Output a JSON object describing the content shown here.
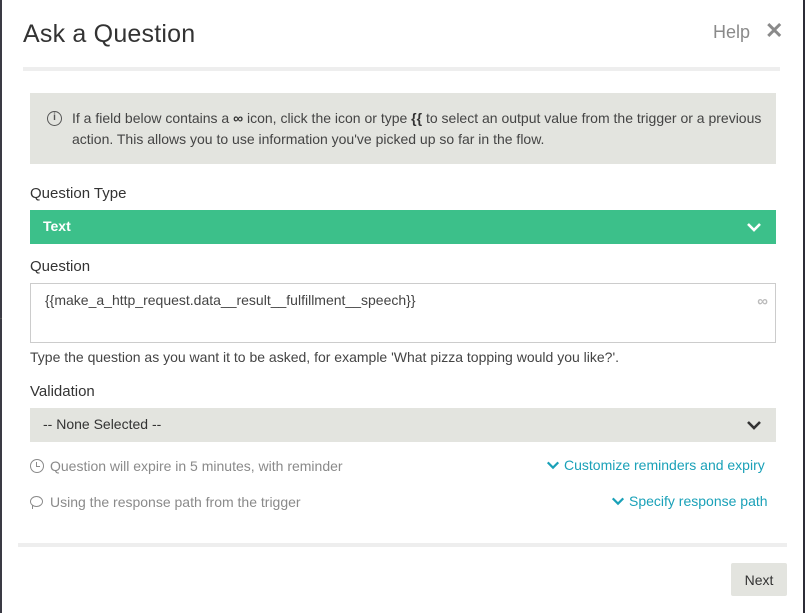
{
  "dialog": {
    "title": "Ask a Question",
    "help_label": "Help",
    "close_glyph": "✕"
  },
  "info": {
    "text_before": "If a field below contains a ",
    "icon_glyph": "∞",
    "text_middle": " icon, click the icon or type ",
    "braces": "{{",
    "text_after": " to select an output value from the trigger or a previous action. This allows you to use information you've picked up so far in the flow."
  },
  "question_type": {
    "label": "Question Type",
    "selected": "Text"
  },
  "question": {
    "label": "Question",
    "value": "{{make_a_http_request.data__result__fulfillment__speech}}",
    "insert_glyph": "∞",
    "hint": "Type the question as you want it to be asked, for example 'What pizza topping would you like?'."
  },
  "validation": {
    "label": "Validation",
    "selected": "-- None Selected --"
  },
  "expiry": {
    "status": "Question will expire in 5 minutes, with reminder",
    "link": "Customize reminders and expiry"
  },
  "response": {
    "status": "Using the response path from the trigger",
    "link": "Specify response path"
  },
  "footer": {
    "next_label": "Next"
  },
  "colors": {
    "accent_green": "#3cc08a",
    "link": "#1aa1b8",
    "panel_grey": "#e3e4df"
  },
  "icons": [
    "info-icon",
    "infinity-icon",
    "chevron-down-icon",
    "clock-icon",
    "speech-bubble-icon",
    "close-icon"
  ]
}
